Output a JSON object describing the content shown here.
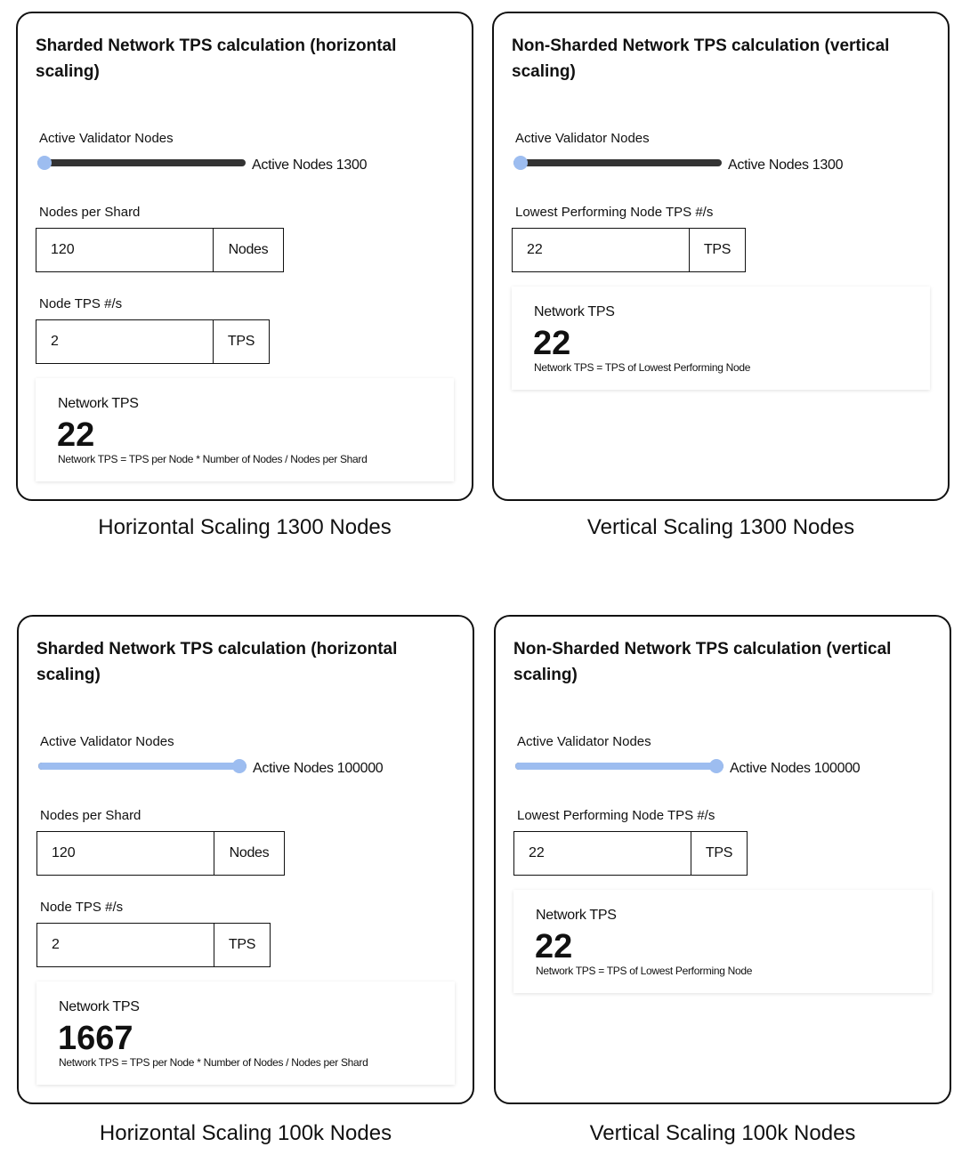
{
  "panels": [
    {
      "title": "Sharded Network TPS calculation (horizontal scaling)",
      "slider_label": "Active Validator Nodes",
      "slider_value_text": "Active Nodes 1300",
      "slider_fraction": 0.0,
      "field1_label": "Nodes per Shard",
      "field1_value": "120",
      "field1_unit": "Nodes",
      "field2_label": "Node TPS #/s",
      "field2_value": "2",
      "field2_unit": "TPS",
      "result_label": "Network TPS",
      "result_value": "22",
      "result_formula": "Network TPS = TPS per Node * Number of Nodes / Nodes per Shard",
      "caption": "Horizontal Scaling 1300 Nodes"
    },
    {
      "title": "Non-Sharded Network TPS calculation (vertical scaling)",
      "slider_label": "Active Validator Nodes",
      "slider_value_text": "Active Nodes 1300",
      "slider_fraction": 0.0,
      "field1_label": "Lowest Performing Node TPS #/s",
      "field1_value": "22",
      "field1_unit": "TPS",
      "result_label": "Network TPS",
      "result_value": "22",
      "result_formula": "Network TPS = TPS of Lowest Performing Node",
      "caption": "Vertical Scaling 1300 Nodes"
    },
    {
      "title": "Sharded Network TPS calculation (horizontal scaling)",
      "slider_label": "Active Validator Nodes",
      "slider_value_text": "Active Nodes 100000",
      "slider_fraction": 1.0,
      "field1_label": "Nodes per Shard",
      "field1_value": "120",
      "field1_unit": "Nodes",
      "field2_label": "Node TPS #/s",
      "field2_value": "2",
      "field2_unit": "TPS",
      "result_label": "Network TPS",
      "result_value": "1667",
      "result_formula": "Network TPS = TPS per Node * Number of Nodes / Nodes per Shard",
      "caption": "Horizontal Scaling 100k Nodes"
    },
    {
      "title": "Non-Sharded Network TPS calculation (vertical scaling)",
      "slider_label": "Active Validator Nodes",
      "slider_value_text": "Active Nodes 100000",
      "slider_fraction": 1.0,
      "field1_label": "Lowest Performing Node TPS #/s",
      "field1_value": "22",
      "field1_unit": "TPS",
      "result_label": "Network TPS",
      "result_value": "22",
      "result_formula": "Network TPS = TPS of Lowest Performing Node",
      "caption": "Vertical Scaling 100k Nodes"
    }
  ],
  "colors": {
    "accent": "#9dbdf0",
    "track": "#333333",
    "border": "#111111"
  }
}
